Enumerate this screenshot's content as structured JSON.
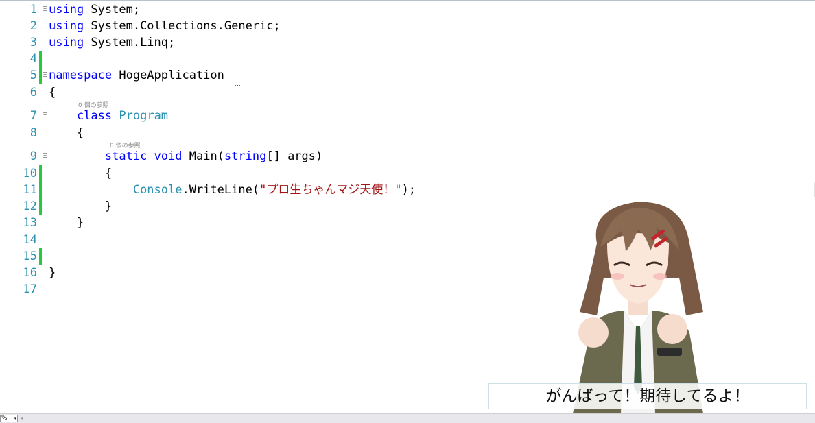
{
  "editor": {
    "line_numbers": [
      "1",
      "2",
      "3",
      "4",
      "5",
      "6",
      "7",
      "8",
      "9",
      "10",
      "11",
      "12",
      "13",
      "14",
      "15",
      "16",
      "17"
    ],
    "codelens": {
      "program_refs": "0 個の参照",
      "main_refs": "0 個の参照"
    },
    "code": {
      "l1_kw": "using",
      "l1_rest": " System;",
      "l2_kw": "using",
      "l2_rest": " System.Collections.Generic;",
      "l3_kw": "using",
      "l3_rest": " System.Linq;",
      "l5_kw": "namespace",
      "l5_rest": " HogeApplication",
      "l6": "{",
      "l7_indent": "    ",
      "l7_kw": "class",
      "l7_sp": " ",
      "l7_type": "Program",
      "l8": "    {",
      "l9_indent": "        ",
      "l9_kw1": "static",
      "l9_sp1": " ",
      "l9_kw2": "void",
      "l9_mid": " Main(",
      "l9_kw3": "string",
      "l9_rest": "[] args)",
      "l10": "        {",
      "l11_indent": "            ",
      "l11_type": "Console",
      "l11_mid": ".WriteLine(",
      "l11_str": "\"プロ生ちゃんマジ天使！\"",
      "l11_end": ");",
      "l12": "        }",
      "l13": "    }",
      "l16": "}"
    }
  },
  "status": {
    "zoom": "%",
    "dropdown_arrow": "▾",
    "scroll_arrow": "◂"
  },
  "subtitle": "がんばって！期待してるよ！",
  "colors": {
    "keyword": "#0000ff",
    "type": "#2b91af",
    "string": "#a31515",
    "change_bar": "#27c93f"
  }
}
